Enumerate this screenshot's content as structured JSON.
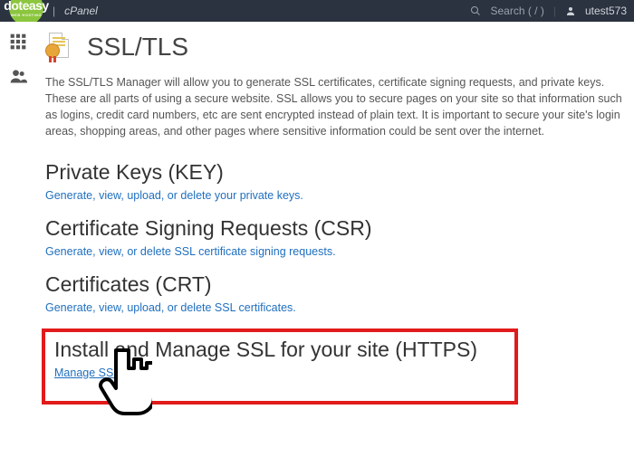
{
  "header": {
    "logo_top": "doteasy",
    "logo_sub": "WEB HOSTING",
    "cpanel": "cPanel",
    "search": "Search ( / )",
    "user": "utest573"
  },
  "page": {
    "title": "SSL/TLS",
    "intro": "The SSL/TLS Manager will allow you to generate SSL certificates, certificate signing requests, and private keys. These are all parts of using a secure website. SSL allows you to secure pages on your site so that information such as logins, credit card numbers, etc are sent encrypted instead of plain text. It is important to secure your site's login areas, shopping areas, and other pages where sensitive information could be sent over the internet."
  },
  "sections": [
    {
      "heading": "Private Keys (KEY)",
      "link": "Generate, view, upload, or delete your private keys."
    },
    {
      "heading": "Certificate Signing Requests (CSR)",
      "link": "Generate, view, or delete SSL certificate signing requests."
    },
    {
      "heading": "Certificates (CRT)",
      "link": "Generate, view, upload, or delete SSL certificates."
    },
    {
      "heading": "Install and Manage SSL for your site (HTTPS)",
      "link": "Manage SSL sites."
    }
  ]
}
